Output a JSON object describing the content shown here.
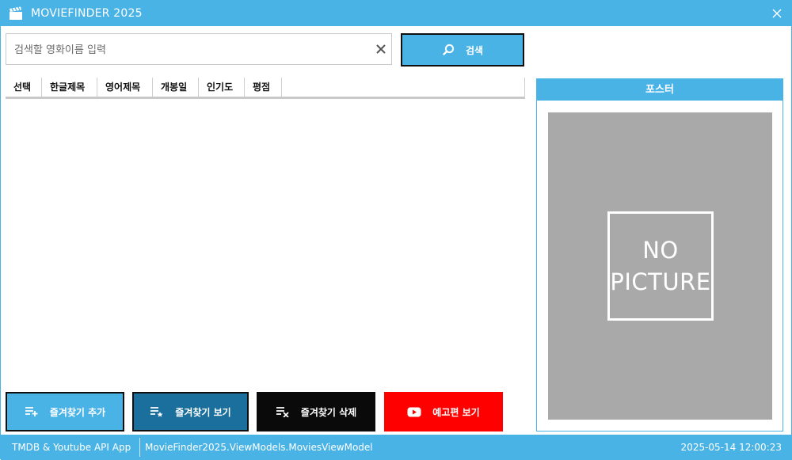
{
  "window": {
    "title": "MOVIEFINDER 2025",
    "icons": {
      "app": "clapperboard-icon",
      "close": "close-icon"
    }
  },
  "search": {
    "placeholder": "검색할 영화이름 입력",
    "value": "",
    "button_label": "검색",
    "icons": {
      "clear": "clear-icon",
      "button": "search-icon"
    }
  },
  "grid": {
    "columns": [
      "선택",
      "한글제목",
      "영어제목",
      "개봉일",
      "인기도",
      "평점"
    ],
    "rows": []
  },
  "poster": {
    "header": "포스터",
    "placeholder_line1": "NO",
    "placeholder_line2": "PICTURE"
  },
  "buttons": {
    "add_favorite": "즐겨찾기 추가",
    "view_favorite": "즐겨찾기 보기",
    "delete_favorite": "즐겨찾기 삭제",
    "watch_trailer": "예고편 보기"
  },
  "statusbar": {
    "app_info": "TMDB & Youtube API App",
    "viewmodel": "MovieFinder2025.ViewModels.MoviesViewModel",
    "datetime": "2025-05-14 12:00:23"
  },
  "colors": {
    "accent": "#4ab3e6",
    "dark_accent": "#1a6f9c",
    "delete": "#0a0a0a",
    "trailer": "#ff0000",
    "poster_bg": "#a9a9a9"
  }
}
